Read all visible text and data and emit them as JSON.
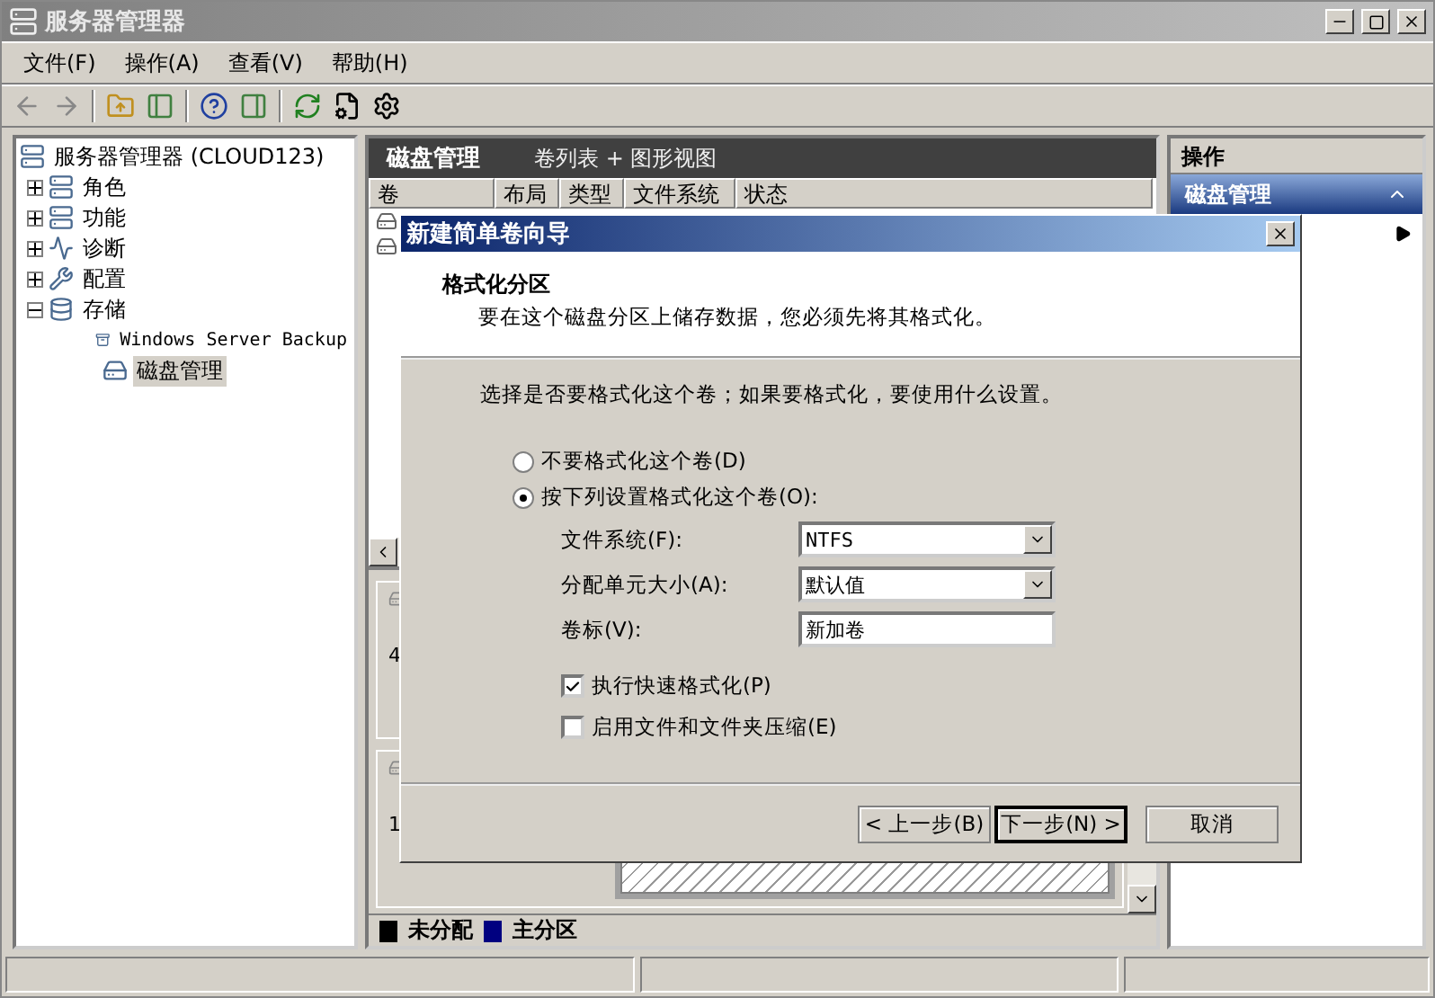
{
  "window": {
    "title": "服务器管理器"
  },
  "menu": [
    "文件(F)",
    "操作(A)",
    "查看(V)",
    "帮助(H)"
  ],
  "tree": {
    "label": "服务器管理器 (CLOUD123)",
    "selected": false,
    "children": [
      {
        "label": "角色",
        "expanded": false,
        "selected": false
      },
      {
        "label": "功能",
        "expanded": false,
        "selected": false
      },
      {
        "label": "诊断",
        "expanded": false,
        "selected": false
      },
      {
        "label": "配置",
        "expanded": false,
        "selected": false
      },
      {
        "label": "存储",
        "expanded": true,
        "selected": false,
        "children": [
          {
            "label": "Windows Server Backup",
            "selected": false
          },
          {
            "label": "磁盘管理",
            "selected": true
          }
        ]
      }
    ]
  },
  "center": {
    "title": "磁盘管理",
    "view": "卷列表 + 图形视图",
    "columns": [
      "卷",
      "布局",
      "类型",
      "文件系统",
      "状态"
    ],
    "disks": [
      {
        "lines": [
          "4"
        ]
      },
      {
        "lines": [
          "1"
        ]
      }
    ],
    "legend": [
      {
        "label": "未分配",
        "color": "#000000"
      },
      {
        "label": "主分区",
        "color": "#000080"
      }
    ]
  },
  "actions": {
    "title": "操作",
    "section": "磁盘管理",
    "expanded": true
  },
  "dialog": {
    "title": "新建简单卷向导",
    "heading": "格式化分区",
    "subtitle": "要在这个磁盘分区上储存数据，您必须先将其格式化。",
    "prompt": "选择是否要格式化这个卷；如果要格式化，要使用什么设置。",
    "options": [
      {
        "label": "不要格式化这个卷(D)",
        "selected": false
      },
      {
        "label": "按下列设置格式化这个卷(O):",
        "selected": true
      }
    ],
    "fields": [
      {
        "kind": "combo",
        "label": "文件系统(F):",
        "value": "NTFS"
      },
      {
        "kind": "combo",
        "label": "分配单元大小(A):",
        "value": "默认值"
      },
      {
        "kind": "text",
        "label": "卷标(V):",
        "value": "新加卷"
      }
    ],
    "checks": [
      {
        "label": "执行快速格式化(P)",
        "checked": true
      },
      {
        "label": "启用文件和文件夹压缩(E)",
        "checked": false
      }
    ],
    "buttons": [
      {
        "label": "< 上一步(B)",
        "default": false
      },
      {
        "label": "下一步(N) >",
        "default": true
      },
      {
        "label": "取消",
        "default": false
      }
    ]
  }
}
